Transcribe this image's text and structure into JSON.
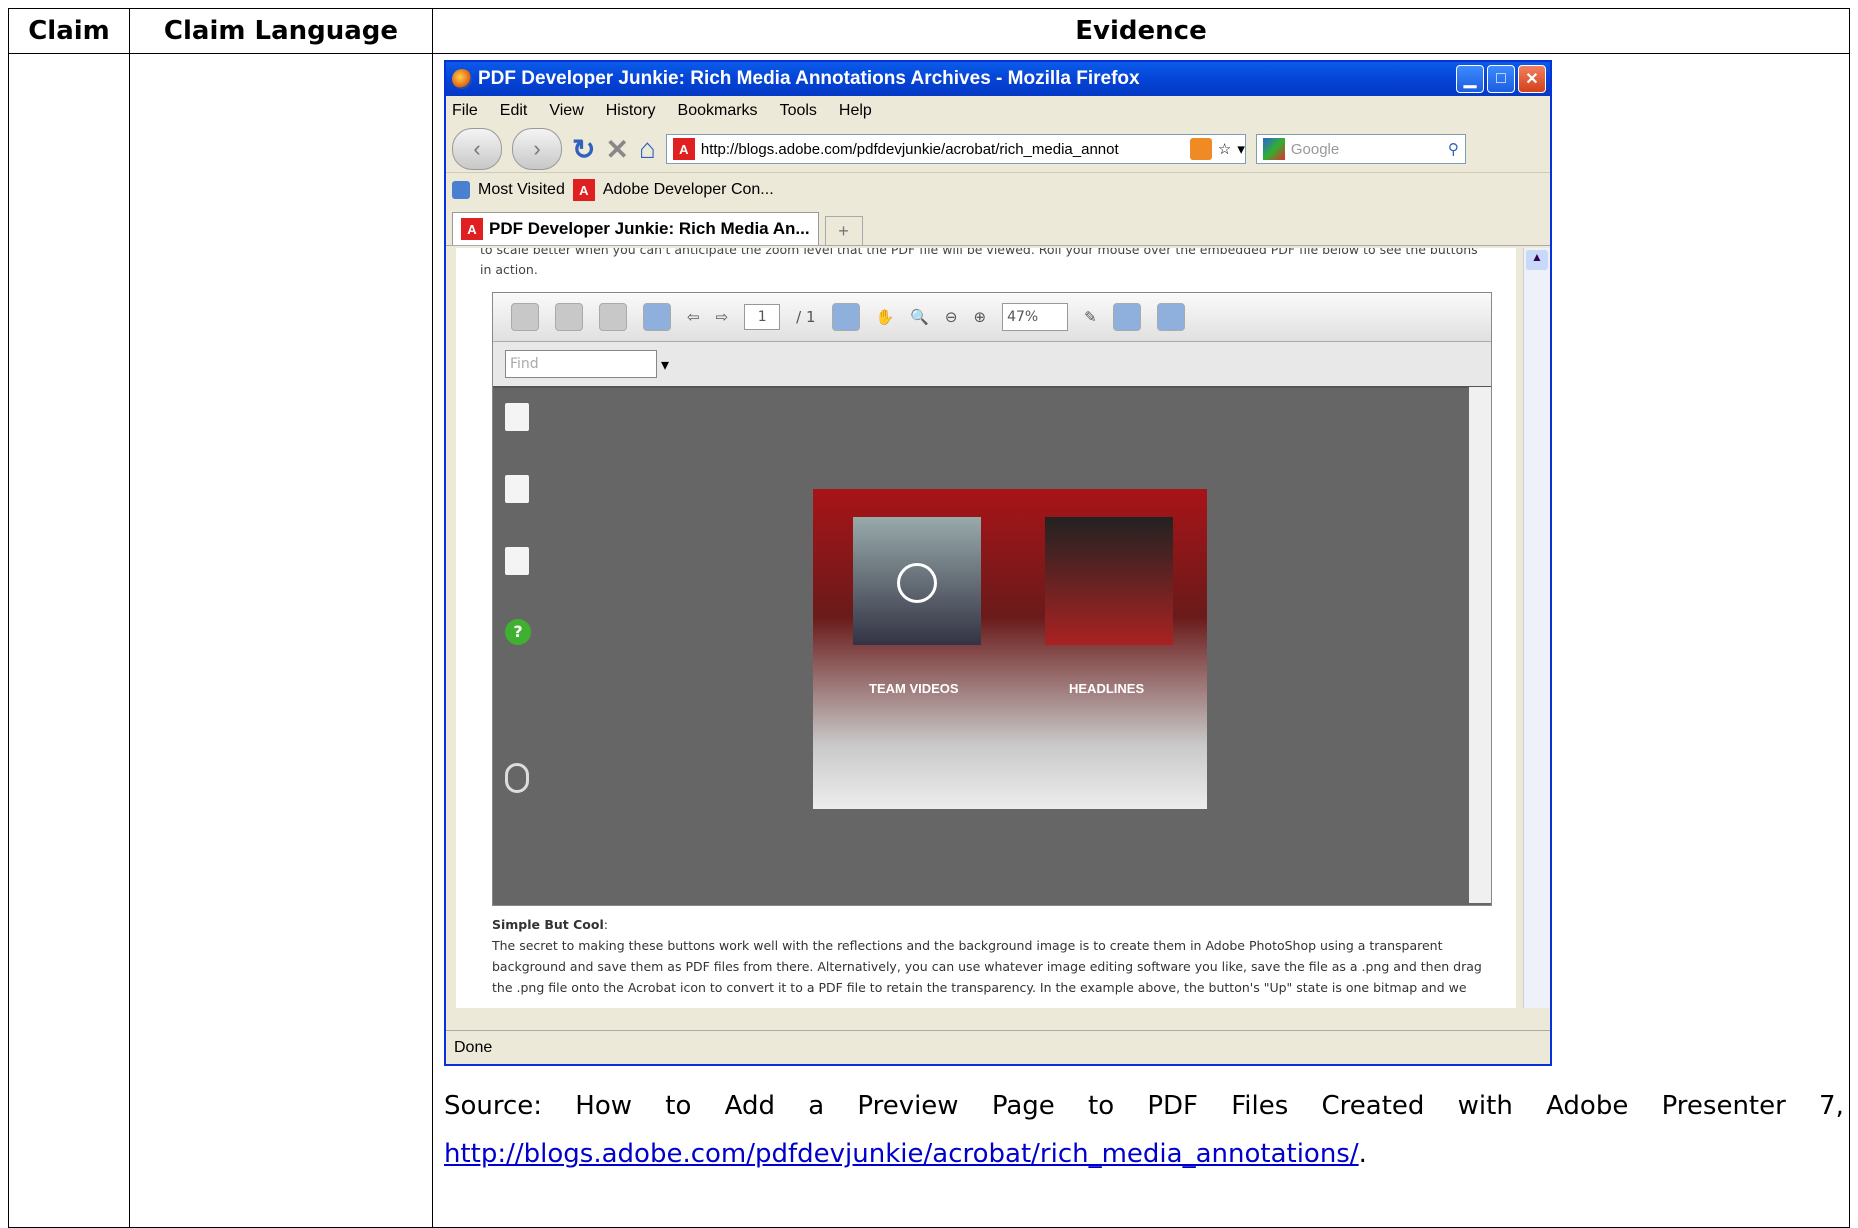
{
  "table": {
    "headers": [
      "Claim",
      "Claim Language",
      "Evidence"
    ]
  },
  "browser": {
    "title": "PDF Developer Junkie: Rich Media Annotations Archives - Mozilla Firefox",
    "menu": [
      "File",
      "Edit",
      "View",
      "History",
      "Bookmarks",
      "Tools",
      "Help"
    ],
    "url": "http://blogs.adobe.com/pdfdevjunkie/acrobat/rich_media_annot",
    "search_placeholder": "Google",
    "bookmarks": [
      "Most Visited",
      "Adobe Developer Con..."
    ],
    "tab_label": "PDF Developer Junkie: Rich Media An...",
    "status": "Done",
    "icons": {
      "back": "back-arrow-icon",
      "forward": "forward-arrow-icon",
      "reload": "reload-icon",
      "stop": "stop-icon",
      "home": "home-icon"
    }
  },
  "page": {
    "lead_text": "to scale better when you can't anticipate the zoom level that the PDF file will be viewed. Roll your mouse over the embedded PDF file below to see the buttons in action.",
    "pdf": {
      "page_current": "1",
      "page_total": "/ 1",
      "zoom": "47%",
      "find_placeholder": "Find",
      "labels": [
        "TEAM VIDEOS",
        "HEADLINES"
      ]
    },
    "after_heading": "Simple But Cool",
    "after_text": "The secret to making these buttons work well with the reflections and the background image is to create them in Adobe PhotoShop using a transparent background and save them as PDF files from there. Alternatively, you can use whatever image editing software you like, save the file as a .png and then drag the .png file onto the Acrobat icon to convert it to a PDF file to retain the transparency. In the example above, the button's \"Up\" state is one bitmap and we"
  },
  "source": {
    "words": [
      "Source:",
      "How",
      "to",
      "Add",
      "a",
      "Preview",
      "Page",
      "to",
      "PDF",
      "Files",
      "Created",
      "with",
      "Adobe",
      "Presenter",
      "7,"
    ],
    "link": "http://blogs.adobe.com/pdfdevjunkie/acrobat/rich_media_annotations/",
    "link_suffix": "."
  }
}
